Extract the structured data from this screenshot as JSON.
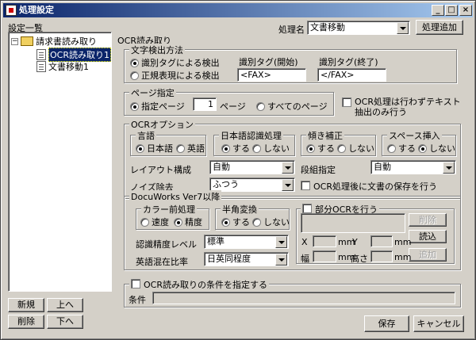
{
  "window": {
    "title": "処理設定",
    "min": "_",
    "max": "□",
    "close": "×"
  },
  "left": {
    "label": "設定一覧",
    "tree": {
      "root": "請求書読み取り",
      "children": [
        "OCR読み取り1",
        "文書移動1"
      ]
    },
    "buttons": {
      "new": "新規",
      "up": "上へ",
      "delete": "削除",
      "down": "下へ"
    }
  },
  "top": {
    "name_label": "処理名",
    "name_value": "文書移動",
    "add_button": "処理追加"
  },
  "section_title": "OCR読み取り",
  "text_detect": {
    "legend": "文字検出方法",
    "opt1": "識別タグによる検出",
    "opt2": "正規表現による検出",
    "start_label": "識別タグ(開始)",
    "start_value": "<FAX>",
    "end_label": "識別タグ(終了)",
    "end_value": "</FAX>"
  },
  "page_spec": {
    "legend": "ページ指定",
    "opt1": "指定ページ",
    "page_value": "1",
    "page_unit": "ページ",
    "opt2": "すべてのページ"
  },
  "no_ocr": {
    "label_line1": "OCR処理は行わずテキスト",
    "label_line2": "抽出のみ行う"
  },
  "ocr_opts": {
    "legend": "OCRオプション",
    "language": {
      "legend": "言語",
      "opt1": "日本語",
      "opt2": "英語"
    },
    "jp": {
      "legend": "日本語認識処理",
      "opt1": "する",
      "opt2": "しない"
    },
    "tilt": {
      "legend": "傾き補正",
      "opt1": "する",
      "opt2": "しない"
    },
    "space": {
      "legend": "スペース挿入",
      "opt1": "する",
      "opt2": "しない"
    },
    "layout_label": "レイアウト構成",
    "layout_value": "自動",
    "column_label": "段組指定",
    "column_value": "自動",
    "noise_label": "ノイズ除去",
    "noise_value": "ふつう",
    "save_after": "OCR処理後に文書の保存を行う"
  },
  "dw": {
    "legend": "DocuWorks Ver7以降",
    "color": {
      "legend": "カラー前処理",
      "opt1": "速度",
      "opt2": "精度"
    },
    "halfwidth": {
      "legend": "半角変換",
      "opt1": "する",
      "opt2": "しない"
    },
    "accuracy_label": "認識精度レベル",
    "accuracy_value": "標準",
    "english_label": "英語混在比率",
    "english_value": "日英同程度",
    "partial": {
      "label": "部分OCRを行う",
      "delete": "削除",
      "load": "読込",
      "add": "追加",
      "x": "X",
      "y": "Y",
      "w": "幅",
      "h": "高さ",
      "unit": "mm"
    }
  },
  "condition": {
    "checkbox": "OCR読み取りの条件を指定する",
    "label": "条件"
  },
  "footer": {
    "save": "保存",
    "cancel": "キャンセル"
  }
}
